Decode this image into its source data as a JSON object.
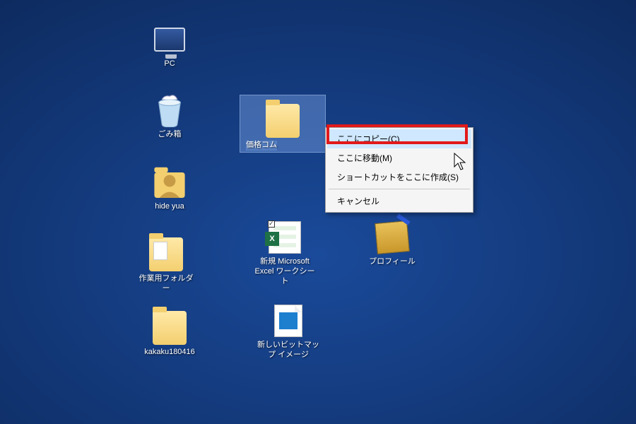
{
  "desktop_icons": {
    "pc": {
      "label": "PC"
    },
    "recycle": {
      "label": "ごみ箱"
    },
    "hideyua": {
      "label": "hide yua"
    },
    "workfolder": {
      "label": "作業用フォルダー"
    },
    "kakaku": {
      "label": "kakaku180416"
    },
    "target": {
      "label": "価格コム"
    },
    "excel": {
      "label": "新規 Microsoft Excel ワークシート"
    },
    "bmp": {
      "label": "新しいビットマップ イメージ"
    },
    "profile": {
      "label": "プロフィール"
    }
  },
  "context_menu": {
    "copy_here": "ここにコピー(C)",
    "move_here": "ここに移動(M)",
    "shortcut_here": "ショートカットをここに作成(S)",
    "cancel": "キャンセル"
  },
  "excel_badge": "X"
}
